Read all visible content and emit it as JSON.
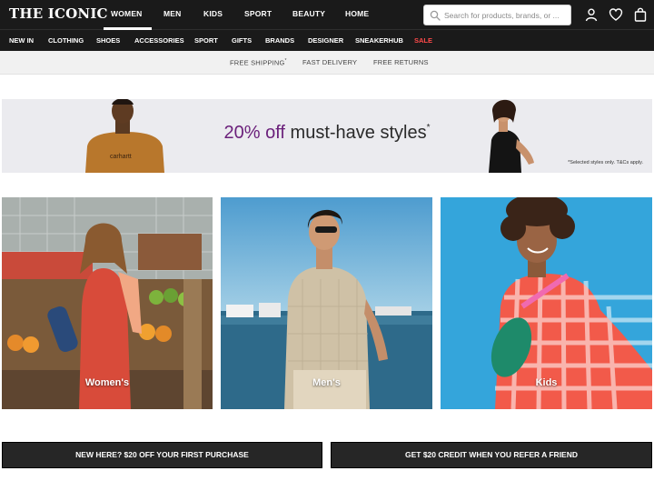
{
  "brand": {
    "name": "THE ICONIC"
  },
  "header": {
    "departments": [
      {
        "label": "WOMEN",
        "active": true
      },
      {
        "label": "MEN",
        "active": false
      },
      {
        "label": "KIDS",
        "active": false
      },
      {
        "label": "SPORT",
        "active": false
      },
      {
        "label": "BEAUTY",
        "active": false
      },
      {
        "label": "HOME",
        "active": false
      }
    ],
    "search": {
      "placeholder": "Search for products, brands, or ...",
      "value": ""
    },
    "icons": [
      "search-icon",
      "account-icon",
      "wishlist-heart-icon",
      "bag-icon"
    ]
  },
  "categories": [
    {
      "label": "NEW IN"
    },
    {
      "label": "CLOTHING"
    },
    {
      "label": "SHOES"
    },
    {
      "label": "ACCESSORIES"
    },
    {
      "label": "SPORT"
    },
    {
      "label": "GIFTS"
    },
    {
      "label": "BRANDS"
    },
    {
      "label": "DESIGNER"
    },
    {
      "label": "SNEAKERHUB"
    },
    {
      "label": "SALE"
    }
  ],
  "promos": [
    "FREE SHIPPING",
    "FAST DELIVERY",
    "FREE RETURNS"
  ],
  "promo_marker": "*",
  "banner": {
    "highlight": "20% off",
    "text": "must-have styles",
    "marker": "*",
    "note": "*Selected styles only. T&Cs apply.",
    "model_left_shirt": "carhartt"
  },
  "tiles": [
    {
      "label": "Women's"
    },
    {
      "label": "Men's"
    },
    {
      "label": "Kids"
    }
  ],
  "cta": [
    {
      "label": "NEW HERE? $20 OFF YOUR FIRST PURCHASE"
    },
    {
      "label": "GET $20 CREDIT WHEN YOU REFER A FRIEND"
    }
  ],
  "colors": {
    "header_bg": "#1a1a1a",
    "sale": "#ff4a4a",
    "banner_highlight": "#6a1f7a",
    "cta_bg": "#262626"
  }
}
